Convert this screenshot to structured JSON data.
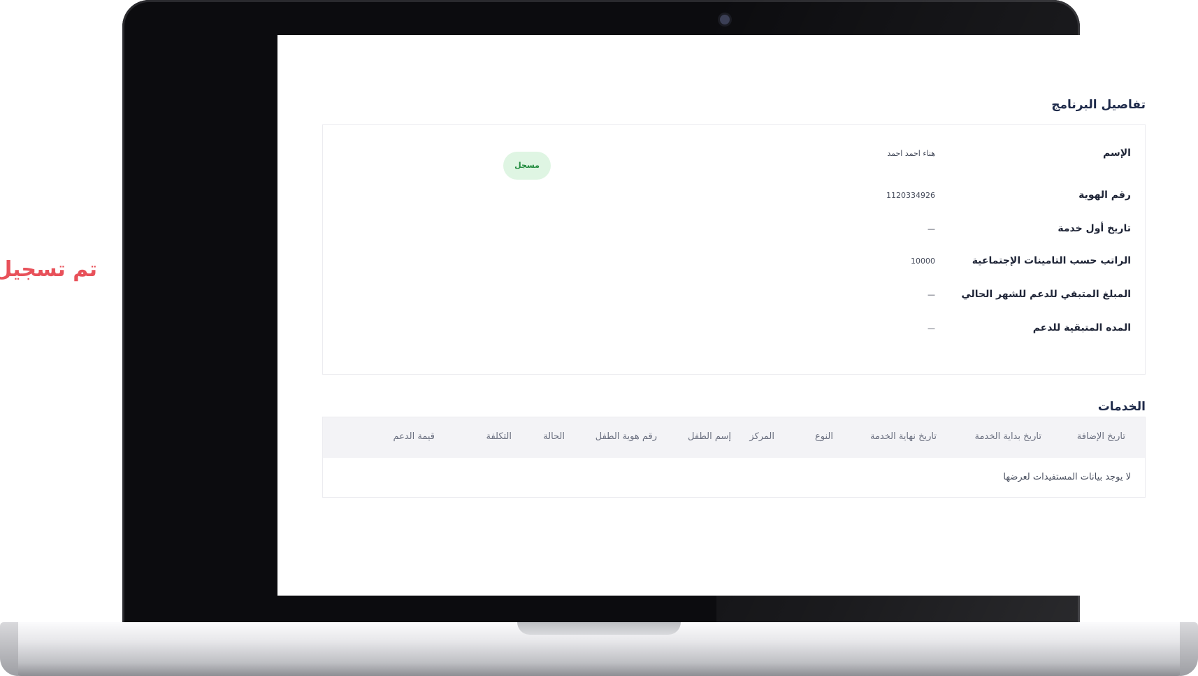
{
  "caption": "تم تسجيل",
  "program": {
    "title": "تفاصيل البرنامج",
    "status_badge": "مسجل",
    "fields": [
      {
        "label": "الإسم",
        "value": "هناء احمد احمد"
      },
      {
        "label": "رقم الهوية",
        "value": "1120334926"
      },
      {
        "label": "تاريخ أول خدمة",
        "value": "—"
      },
      {
        "label": "الراتب حسب التامينات الإجتماعية",
        "value": "10000"
      },
      {
        "label": "المبلغ المتبقي للدعم للشهر الحالي",
        "value": "—"
      },
      {
        "label": "المده المتبقية للدعم",
        "value": "—"
      }
    ]
  },
  "services": {
    "title": "الخدمات",
    "columns": [
      "تاريخ الإضافة",
      "تاريخ بداية الخدمة",
      "تاريخ نهاية الخدمة",
      "النوع",
      "المركز",
      "إسم الطفل",
      "رقم هوية الطفل",
      "الحالة",
      "التكلفة",
      "قيمة الدعم"
    ],
    "empty_message": "لا يوجد بيانات المستفيدات لعرضها"
  }
}
